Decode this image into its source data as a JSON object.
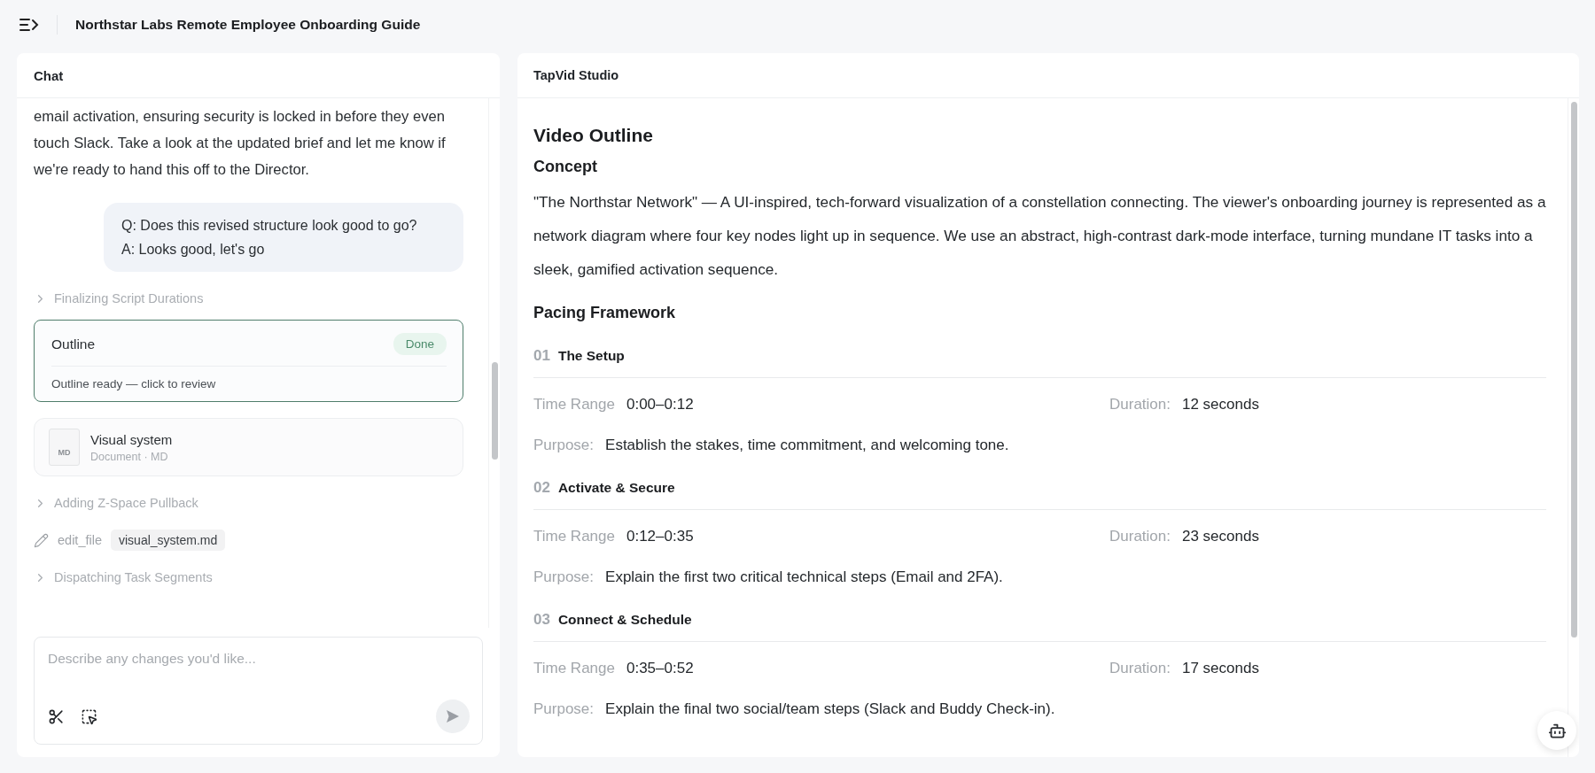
{
  "header": {
    "title": "Northstar Labs Remote Employee Onboarding Guide"
  },
  "chat": {
    "title": "Chat",
    "messages": [
      {
        "kind": "assistant",
        "text": "email activation, ensuring security is locked in before they even touch Slack. Take a look at the updated brief and let me know if we're ready to hand this off to the Director."
      },
      {
        "kind": "user",
        "lines": [
          "Q: Does this revised structure look good to go?",
          "A: Looks good, let's go"
        ]
      },
      {
        "kind": "step",
        "label": "Finalizing Script Durations",
        "expanded": false
      },
      {
        "kind": "artifact",
        "title": "Outline",
        "status": "Done",
        "note": "Outline ready — click to review",
        "selected": true
      },
      {
        "kind": "file",
        "badge": "MD",
        "title": "Visual system",
        "meta": "Document · MD"
      },
      {
        "kind": "step",
        "label": "Adding Z-Space Pullback",
        "expanded": false
      },
      {
        "kind": "tool",
        "name": "edit_file",
        "file": "visual_system.md"
      },
      {
        "kind": "step",
        "label": "Dispatching Task Segments",
        "expanded": false
      }
    ],
    "composer": {
      "placeholder": "Describe any changes you'd like..."
    }
  },
  "studio": {
    "title": "TapVid Studio",
    "heading": "Video Outline",
    "concept": {
      "heading": "Concept",
      "text": "\"The Northstar Network\" — A UI-inspired, tech-forward visualization of a constellation connecting. The viewer's onboarding journey is represented as a network diagram where four key nodes light up in sequence. We use an abstract, high-contrast dark-mode interface, turning mundane IT tasks into a sleek, gamified activation sequence."
    },
    "pacing": {
      "heading": "Pacing Framework",
      "segments": [
        {
          "number": "01",
          "title": "The Setup",
          "time_label": "Time Range",
          "time": "0:00–0:12",
          "duration_label": "Duration:",
          "duration": "12 seconds",
          "purpose_label": "Purpose:",
          "purpose": "Establish the stakes, time commitment, and welcoming tone."
        },
        {
          "number": "02",
          "title": "Activate & Secure",
          "time_label": "Time Range",
          "time": "0:12–0:35",
          "duration_label": "Duration:",
          "duration": "23 seconds",
          "purpose_label": "Purpose:",
          "purpose": "Explain the first two critical technical steps (Email and 2FA)."
        },
        {
          "number": "03",
          "title": "Connect & Schedule",
          "time_label": "Time Range",
          "time": "0:35–0:52",
          "duration_label": "Duration:",
          "duration": "17 seconds",
          "purpose_label": "Purpose:",
          "purpose": "Explain the final two social/team steps (Slack and Buddy Check-in)."
        }
      ]
    }
  }
}
